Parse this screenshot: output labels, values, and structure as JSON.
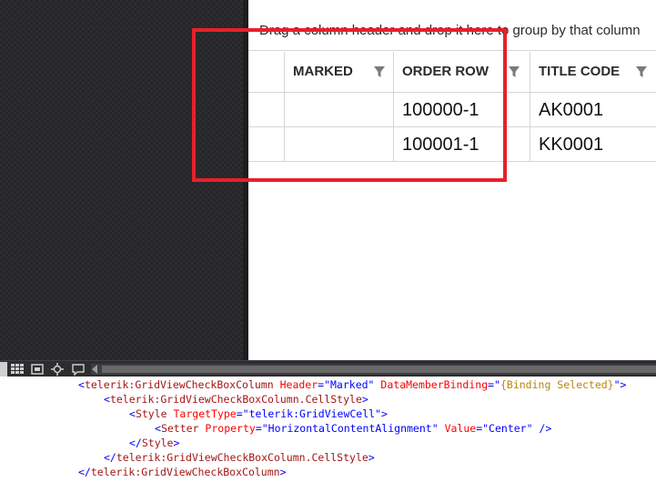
{
  "grid": {
    "group_panel_text": "Drag a column header and drop it here to group by that column",
    "columns": [
      {
        "label": "MARKED"
      },
      {
        "label": "ORDER ROW"
      },
      {
        "label": "TITLE CODE"
      }
    ],
    "rows": [
      {
        "marked": "",
        "order_row": "100000-1",
        "title_code": "AK0001"
      },
      {
        "marked": "",
        "order_row": "100001-1",
        "title_code": "KK0001"
      }
    ]
  },
  "toolbar": {
    "icons": [
      "grid-view-icon",
      "snap-grid-icon",
      "fit-selection-icon",
      "crosshair-icon",
      "comment-icon"
    ]
  },
  "code": {
    "line1": {
      "open": "<",
      "tag": "telerik:GridViewCheckBoxColumn",
      "a1": "Header",
      "eq1": "=\"",
      "v1": "Marked",
      "q1": "\"",
      "a2": "DataMemberBinding",
      "eq2": "=\"",
      "v2": "{Binding Selected}",
      "q2": "\">"
    },
    "line2": {
      "open": "<",
      "tag": "telerik:GridViewCheckBoxColumn.CellStyle",
      "close": ">"
    },
    "line3": {
      "open": "<",
      "tag": "Style",
      "a1": "TargetType",
      "eq1": "=\"",
      "v1": "telerik:GridViewCell",
      "q1": "\">"
    },
    "line4": {
      "open": "<",
      "tag": "Setter",
      "a1": "Property",
      "eq1": "=\"",
      "v1": "HorizontalContentAlignment",
      "q1": "\"",
      "a2": "Value",
      "eq2": "=\"",
      "v2": "Center",
      "q2": "\" />"
    },
    "line5": {
      "open": "</",
      "tag": "Style",
      "close": ">"
    },
    "line6": {
      "open": "</",
      "tag": "telerik:GridViewCheckBoxColumn.CellStyle",
      "close": ">"
    },
    "line7": {
      "open": "</",
      "tag": "telerik:GridViewCheckBoxColumn",
      "close": ">"
    }
  },
  "colors": {
    "highlight_border": "#e8202a",
    "designer_background": "#2d2d30",
    "xml_tag": "#a31515",
    "xml_attribute": "#ff0000",
    "xml_value": "#0000ff",
    "binding_markup": "#b8860b"
  }
}
